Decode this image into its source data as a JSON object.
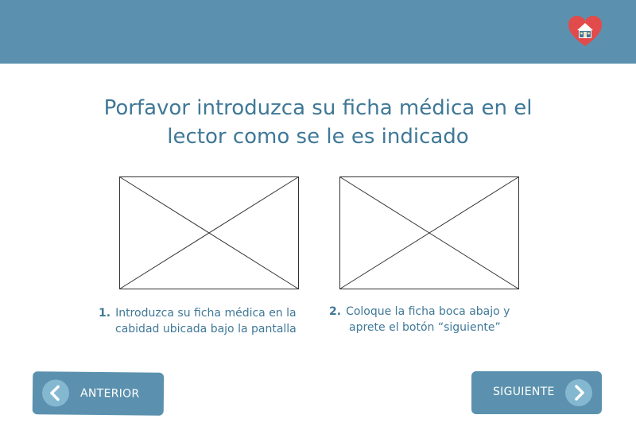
{
  "header": {
    "logo_icon": "heart-house-icon",
    "background_color": "#5b91ae"
  },
  "main": {
    "title_line1": "Porfavor introduzca su ficha médica en el",
    "title_line2": "lector como se le es indicado",
    "steps": [
      {
        "number": "1.",
        "line1": "Introduzca su ficha médica en la",
        "line2": "cabidad ubicada bajo la pantalla"
      },
      {
        "number": "2.",
        "line1": "Coloque la ficha boca abajo y",
        "line2": "aprete el botón “siguiente”"
      }
    ]
  },
  "footer": {
    "prev_label": "ANTERIOR",
    "prev_icon": "chevron-left-icon",
    "next_label": "SIGUIENTE",
    "next_icon": "chevron-right-icon"
  },
  "colors": {
    "accent": "#5b91ae",
    "text": "#3f7897",
    "circle": "#84b8d1",
    "logo_heart": "#e24b4b"
  }
}
